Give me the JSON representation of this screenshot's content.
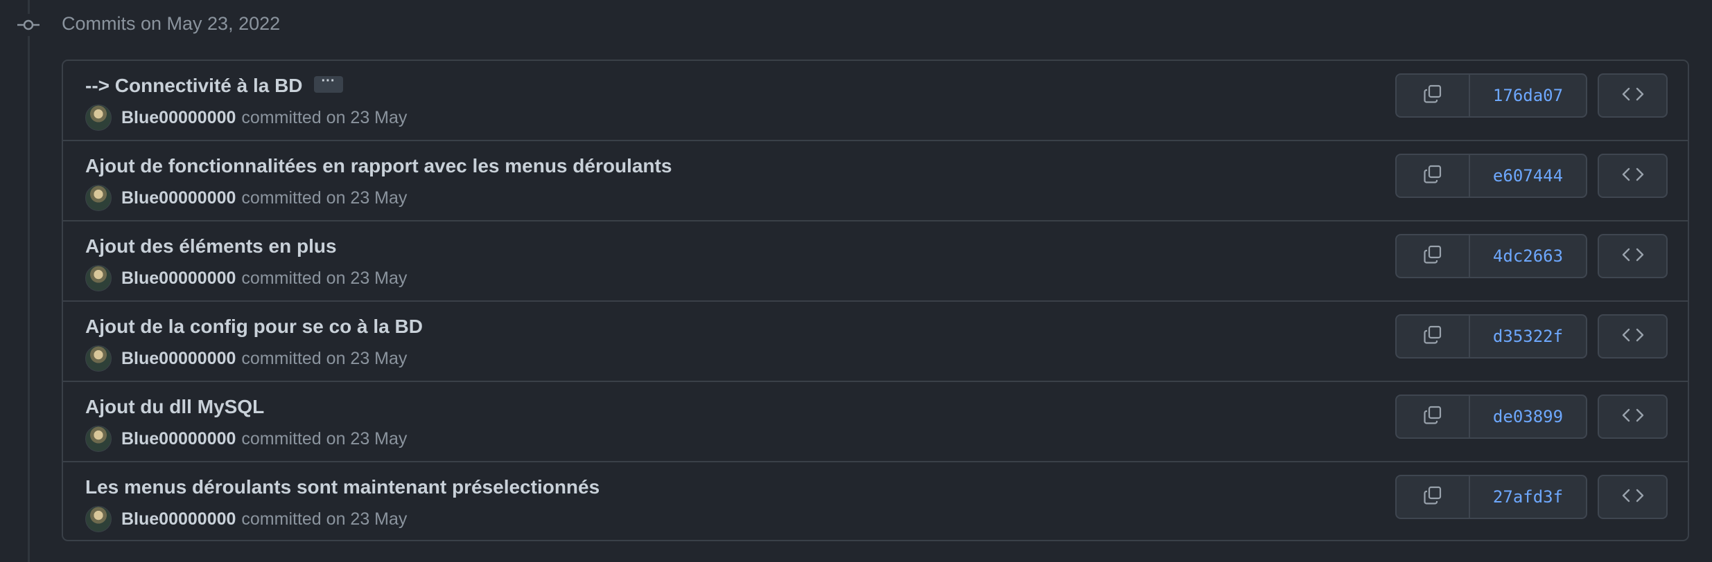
{
  "group": {
    "heading": "Commits on May 23, 2022",
    "icon": "git-commit-icon"
  },
  "commits": [
    {
      "title": "--> Connectivité à la BD",
      "has_ellipsis": true,
      "ellipsis_label": "···",
      "author": "Blue00000000",
      "meta": "committed on 23 May",
      "sha": "176da07"
    },
    {
      "title": "Ajout de fonctionnalitées en rapport avec les menus déroulants",
      "has_ellipsis": false,
      "author": "Blue00000000",
      "meta": "committed on 23 May",
      "sha": "e607444"
    },
    {
      "title": "Ajout des éléments en plus",
      "has_ellipsis": false,
      "author": "Blue00000000",
      "meta": "committed on 23 May",
      "sha": "4dc2663"
    },
    {
      "title": "Ajout de la config pour se co à la BD",
      "has_ellipsis": false,
      "author": "Blue00000000",
      "meta": "committed on 23 May",
      "sha": "d35322f"
    },
    {
      "title": "Ajout du dll MySQL",
      "has_ellipsis": false,
      "author": "Blue00000000",
      "meta": "committed on 23 May",
      "sha": "de03899"
    },
    {
      "title": "Les menus déroulants sont maintenant préselectionnés",
      "has_ellipsis": false,
      "author": "Blue00000000",
      "meta": "committed on 23 May",
      "sha": "27afd3f"
    }
  ],
  "icons": {
    "copy": "copy-icon",
    "browse": "code-icon"
  },
  "colors": {
    "background": "#22262d",
    "border": "#3a4048",
    "sha_link": "#6ea8fe",
    "muted_text": "#8b949e"
  }
}
